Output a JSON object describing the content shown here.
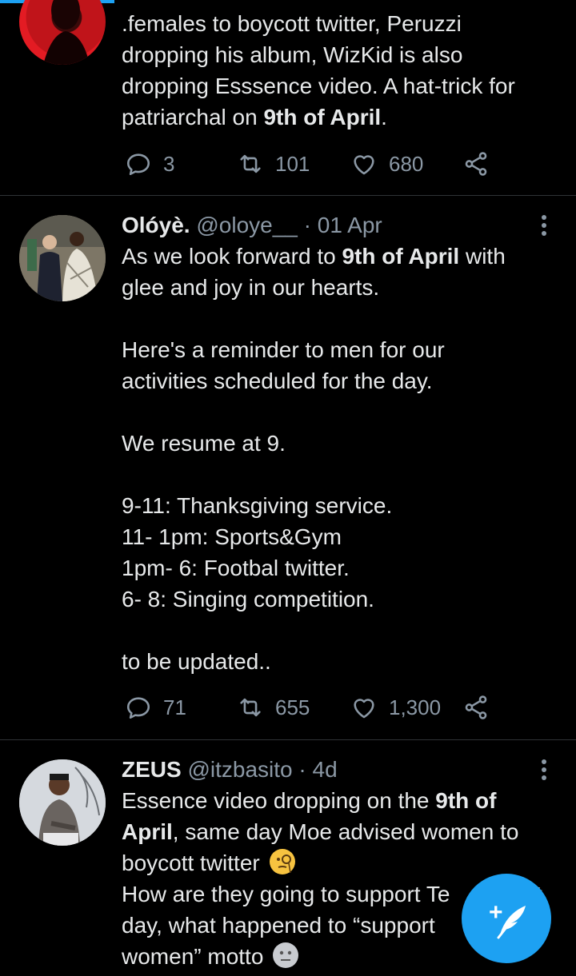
{
  "tweets": [
    {
      "body_parts": [
        {
          "text": ".females to boycott twitter, Peruzzi\ndropping his album, WizKid is also\ndropping Esssence video. A hat-trick for\npatriarchal on ",
          "bold": false
        },
        {
          "text": "9th of April",
          "bold": true
        },
        {
          "text": ".",
          "bold": false
        }
      ],
      "replies": "3",
      "retweets": "101",
      "likes": "680"
    },
    {
      "name": "Olóyè.",
      "handle": "@oloye__",
      "time": "· 01 Apr",
      "body_parts": [
        {
          "text": "As we look forward to ",
          "bold": false
        },
        {
          "text": "9th of April",
          "bold": true
        },
        {
          "text": " with\nglee and joy in our hearts.\n\nHere's a reminder to men for our\nactivities scheduled for the day.\n\nWe resume at 9.\n\n9-11: Thanksgiving service.\n11- 1pm: Sports&Gym\n1pm- 6: Footbal twitter.\n6- 8: Singing competition.\n\nto be updated..",
          "bold": false
        }
      ],
      "replies": "71",
      "retweets": "655",
      "likes": "1,300"
    },
    {
      "name": "ZEUS",
      "handle": "@itzbasito",
      "time": "· 4d",
      "body_parts": [
        {
          "text": "Essence video dropping on the ",
          "bold": false
        },
        {
          "text": "9th of\nApril",
          "bold": true
        },
        {
          "text": ", same day Moe advised women to\nboycott twitter ",
          "bold": false
        }
      ],
      "emoji1": "face-with-monocle-emoji",
      "body_parts_2": [
        {
          "text": "\nHow are they going to support Te",
          "bold": false
        },
        {
          "text": "t",
          "bold": false
        }
      ],
      "line_day": "day, what happened to “support",
      "line_women": "women” motto",
      "emoji2": "neutral-face-emoji"
    }
  ],
  "fab": {
    "icon": "compose-tweet-icon",
    "plus": "+"
  },
  "colors": {
    "accent": "#1da1f2",
    "muted": "#8b98a5",
    "background": "#000000",
    "text": "#e7e9ea"
  }
}
